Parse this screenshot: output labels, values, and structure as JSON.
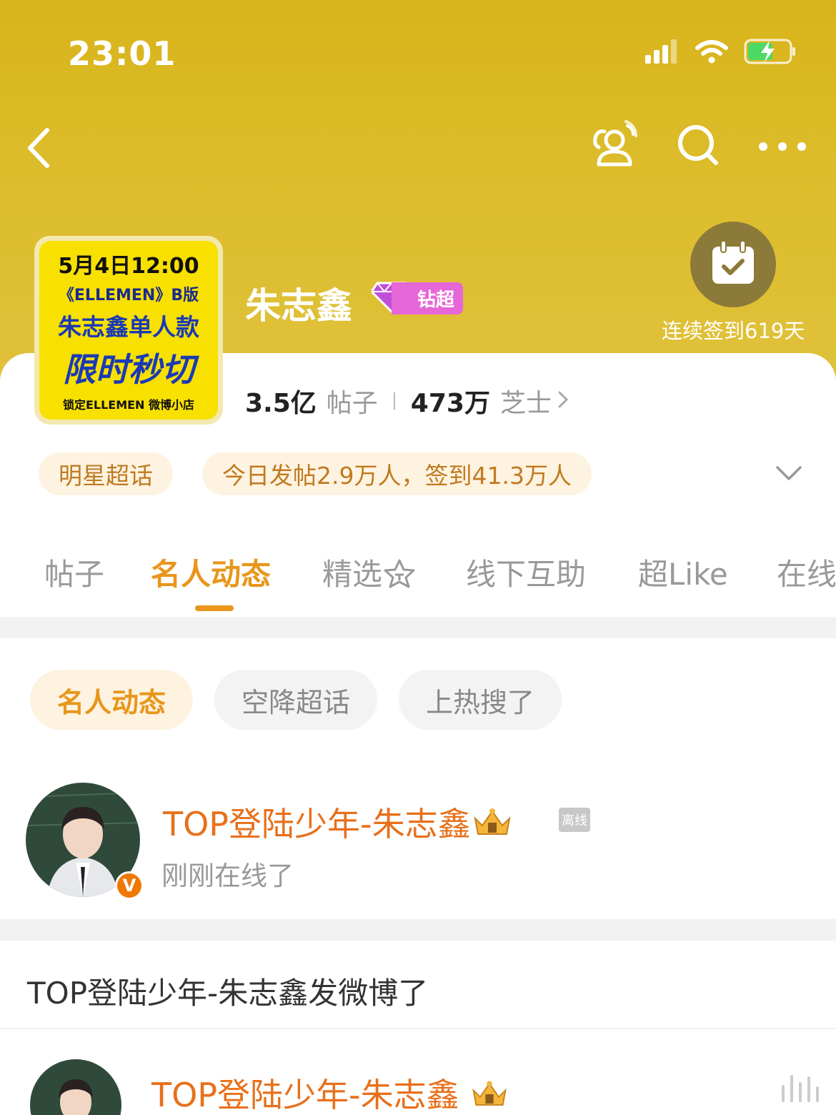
{
  "status_bar": {
    "time": "23:01"
  },
  "supertopic": {
    "title": "朱志鑫",
    "badge_level": "2",
    "badge_label": "钻超",
    "cover": {
      "line1": "5月4日12:00",
      "line2": "《ELLEMEN》B版",
      "line3": "朱志鑫单人款",
      "line4": "限时秒切",
      "line5": "锁定ELLEMEN 微博小店"
    },
    "checkin_text": "连续签到619天",
    "posts_count": "3.5亿",
    "posts_label": "帖子",
    "fans_count": "473万",
    "fans_label": "芝士"
  },
  "chips": {
    "category": "明星超话",
    "today": "今日发帖2.9万人，签到41.3万人"
  },
  "tabs": [
    "帖子",
    "名人动态",
    "精选",
    "线下互助",
    "超Like",
    "在线"
  ],
  "active_tab": "名人动态",
  "filter_pills": [
    "名人动态",
    "空降超话",
    "上热搜了"
  ],
  "celebrity_online": {
    "name": "TOP登陆少年-朱志鑫",
    "status_tag": "离线",
    "subtitle": "刚刚在线了",
    "verified_mark": "V"
  },
  "post": {
    "heading": "TOP登陆少年-朱志鑫发微博了",
    "author": "TOP登陆少年-朱志鑫"
  },
  "colors": {
    "header": "#d8b41a",
    "accent": "#e8961b",
    "name": "#e8701b"
  }
}
